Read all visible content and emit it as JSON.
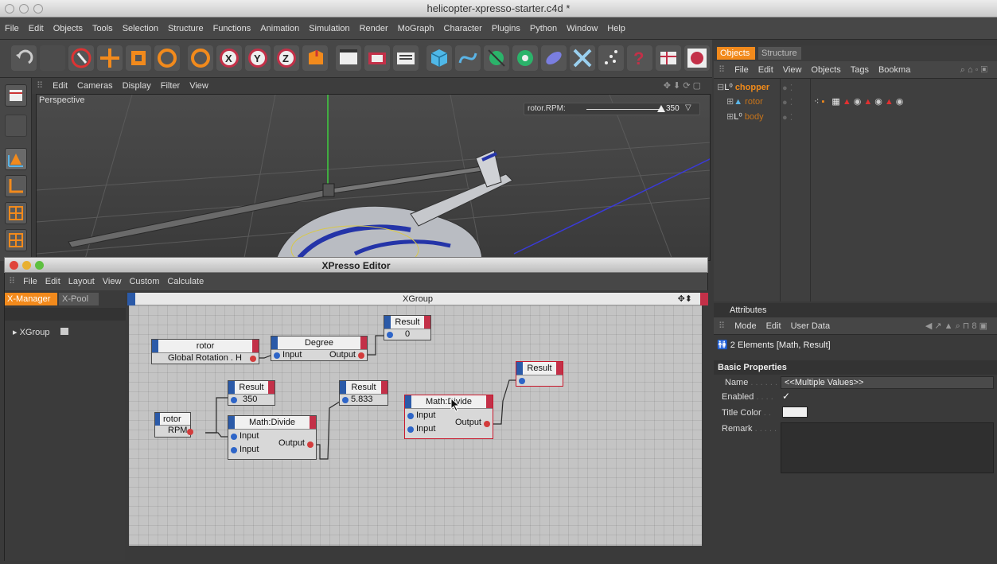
{
  "window": {
    "title": "helicopter-xpresso-starter.c4d *"
  },
  "menubar": [
    "File",
    "Edit",
    "Objects",
    "Tools",
    "Selection",
    "Structure",
    "Functions",
    "Animation",
    "Simulation",
    "Render",
    "MoGraph",
    "Character",
    "Plugins",
    "Python",
    "Window",
    "Help"
  ],
  "viewport": {
    "menu": [
      "Edit",
      "Cameras",
      "Display",
      "Filter",
      "View"
    ],
    "label": "Perspective",
    "hud_label": "rotor.RPM:",
    "hud_value": "350"
  },
  "objects": {
    "tabs": [
      "Objects",
      "Structure"
    ],
    "menu": [
      "File",
      "Edit",
      "View",
      "Objects",
      "Tags",
      "Bookma"
    ],
    "items": [
      {
        "name": "chopper"
      },
      {
        "name": "rotor"
      },
      {
        "name": "body"
      }
    ]
  },
  "attributes": {
    "header": "Attributes",
    "menu": [
      "Mode",
      "Edit",
      "User Data"
    ],
    "elements": "2 Elements [Math, Result]",
    "section": "Basic Properties",
    "rows": [
      {
        "label": "Name",
        "dots": ". . . . . .",
        "value": "<<Multiple Values>>"
      },
      {
        "label": "Enabled",
        "dots": ". . . .",
        "value": "✓"
      },
      {
        "label": "Title Color",
        "dots": ". ."
      },
      {
        "label": "Remark",
        "dots": ". . . . ."
      }
    ]
  },
  "xpresso": {
    "title": "XPresso Editor",
    "menu": [
      "File",
      "Edit",
      "Layout",
      "View",
      "Custom",
      "Calculate"
    ],
    "tabs": [
      "X-Manager",
      "X-Pool"
    ],
    "tree_item": "XGroup",
    "group_title": "XGroup",
    "nodes": {
      "rotor_rot": {
        "title": "rotor",
        "port": "Global Rotation . H"
      },
      "degree": {
        "title": "Degree",
        "in": "Input",
        "out": "Output"
      },
      "result_top": {
        "title": "Result",
        "value": "0"
      },
      "rotor_rpm": {
        "title": "rotor",
        "port": "RPM"
      },
      "result_350": {
        "title": "Result",
        "value": "350"
      },
      "math1": {
        "title": "Math:Divide",
        "in1": "Input",
        "in2": "Input",
        "out": "Output"
      },
      "result_5833": {
        "title": "Result",
        "value": "5.833"
      },
      "math2": {
        "title": "Math:Divide",
        "in1": "Input",
        "in2": "Input",
        "out": "Output"
      },
      "result_right": {
        "title": "Result"
      }
    }
  },
  "colors": {
    "port_in": "#2e65c8",
    "port_out": "#d33c3c",
    "selection": "#c8182c",
    "object_name": "#e88a1a"
  }
}
